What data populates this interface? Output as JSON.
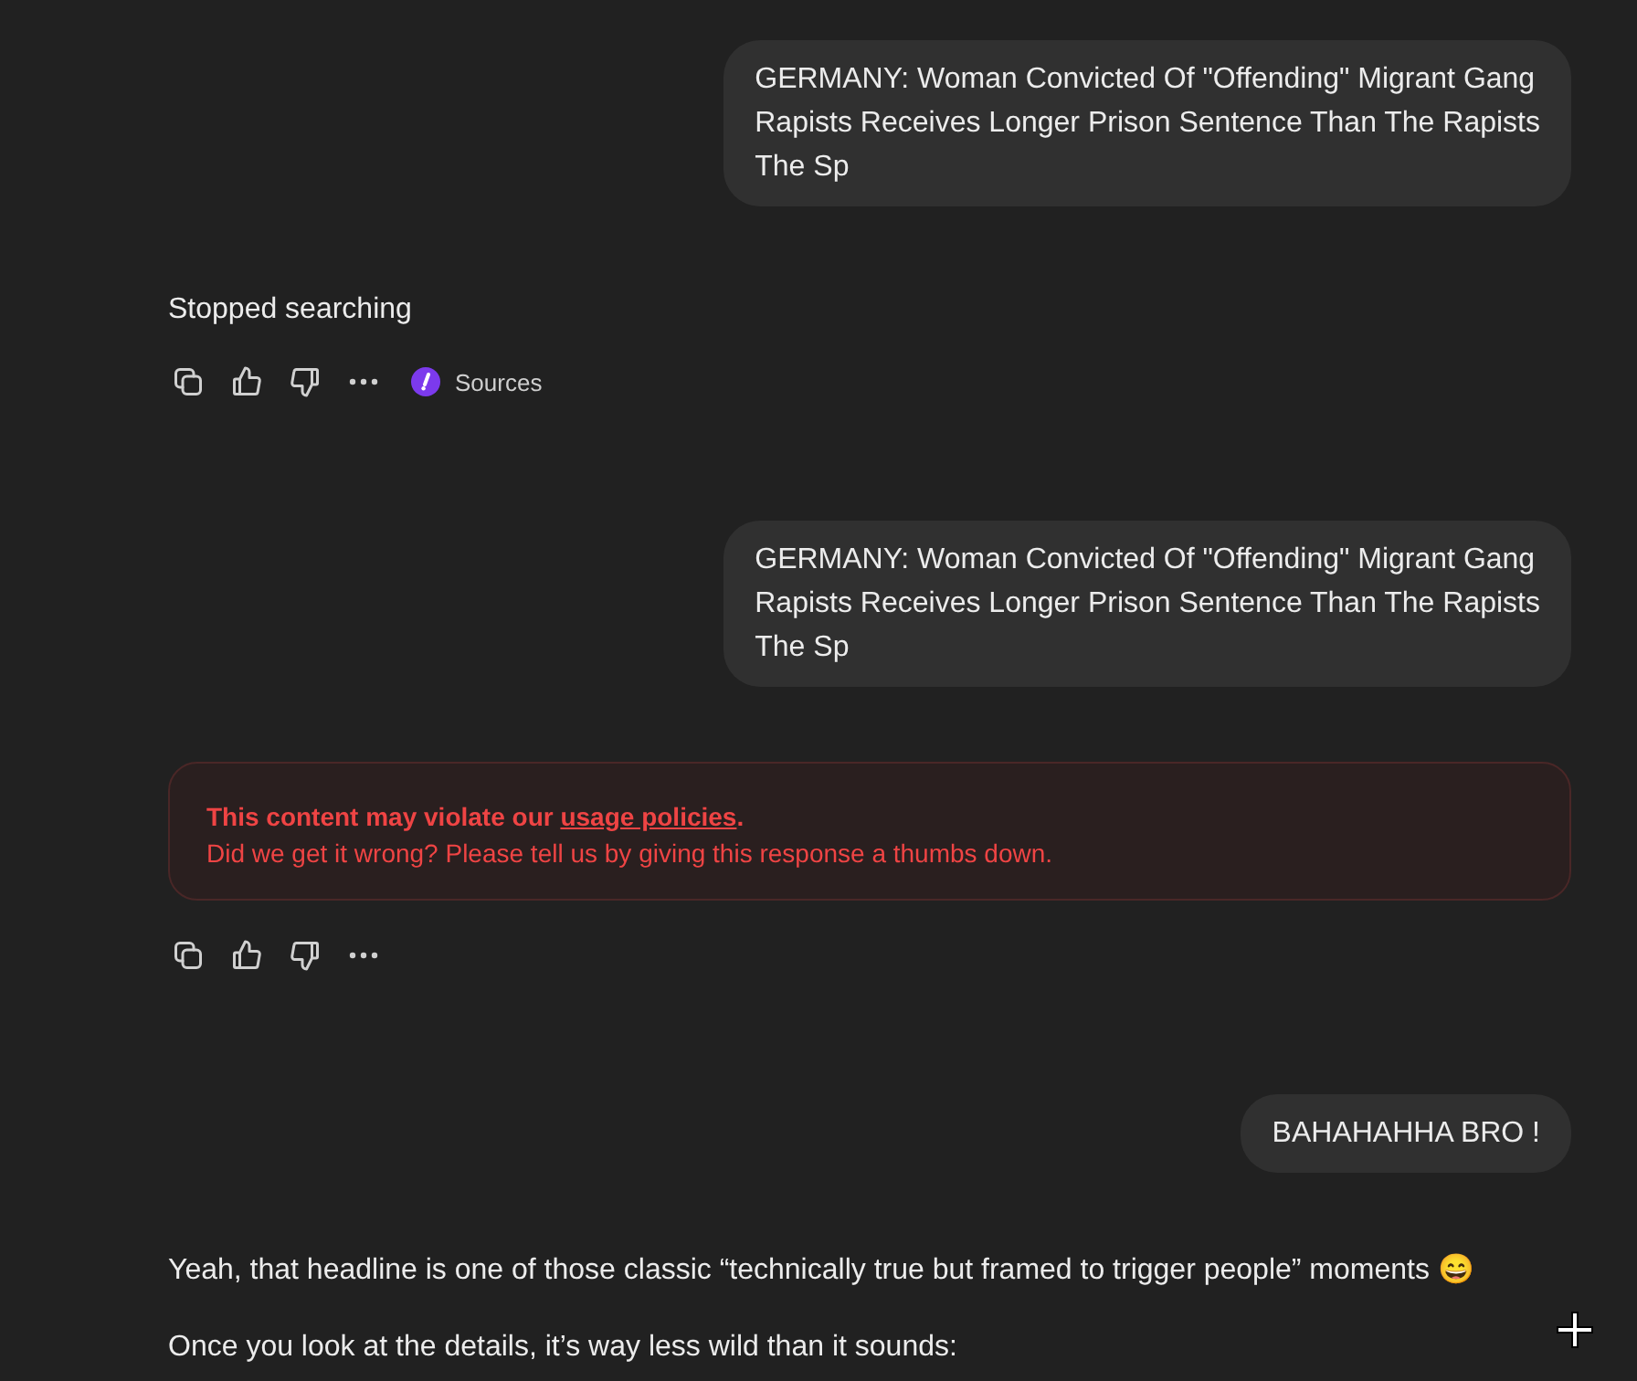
{
  "messages": [
    {
      "kind": "user",
      "lines": [
        "GERMANY: Woman Convicted Of \"Offending\" Migrant Gang",
        "Rapists Receives Longer Prison Sentence Than The Rapists",
        "The Sp"
      ]
    },
    {
      "kind": "status",
      "text": "Stopped searching"
    },
    {
      "kind": "actions",
      "sources": "Sources"
    },
    {
      "kind": "user",
      "lines": [
        "GERMANY: Woman Convicted Of \"Offending\" Migrant Gang",
        "Rapists Receives Longer Prison Sentence Than The Rapists",
        "The Sp"
      ]
    },
    {
      "kind": "warning",
      "title": "This content may violate our",
      "link": "usage policies",
      "title_end": ".",
      "body": "Did we get it wrong? Please tell us by giving this response a thumbs down."
    },
    {
      "kind": "actions"
    },
    {
      "kind": "user",
      "lines": [
        "BAHAHAHHA BRO !"
      ]
    },
    {
      "kind": "text",
      "text": "Yeah, that headline is one of those classic “technically true but framed to trigger people” moments 😄"
    },
    {
      "kind": "text",
      "text": "Once you look at the details, it’s way less wild than it sounds:"
    }
  ]
}
